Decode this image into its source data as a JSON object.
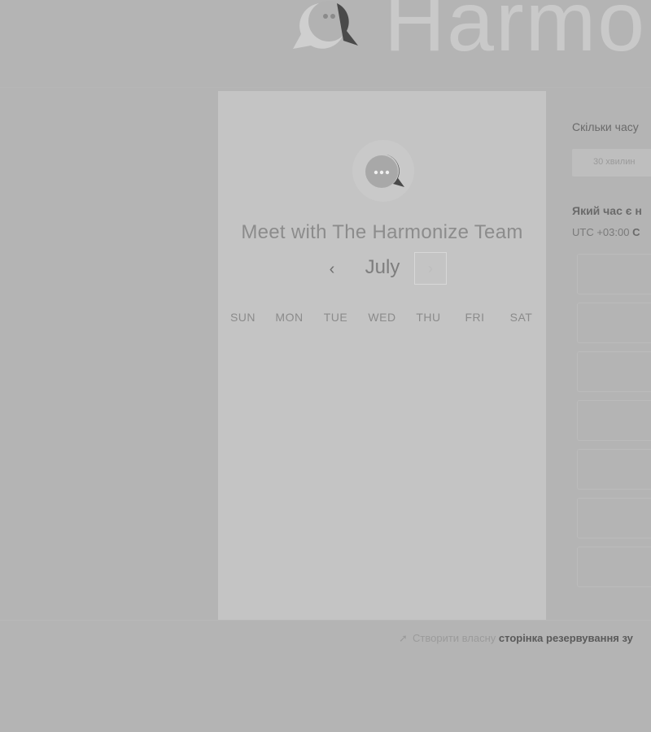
{
  "header": {
    "brand_text": "Harmo"
  },
  "card": {
    "title": "Meet with The Harmonize Team",
    "month": "July",
    "prev_icon": "chevron-left-icon",
    "next_icon": "chevron-right-icon",
    "weekdays": [
      "SUN",
      "MON",
      "TUE",
      "WED",
      "THU",
      "FRI",
      "SAT"
    ]
  },
  "right_panel": {
    "duration_question": "Скільки часу",
    "duration_option": "30 хвилин",
    "time_question": "Який час є н",
    "timezone_prefix": "UTC +03:00",
    "timezone_name": "С",
    "slot_count": 7
  },
  "footer": {
    "link_plain": "Створити власну",
    "link_bold": "сторінка резервування зу",
    "icon": "pointer-icon"
  },
  "colors": {
    "background": "#b4b4b4",
    "card": "#c4c4c4",
    "logo_dark": "#4a4a4a",
    "logo_light": "#a9a9a9"
  }
}
